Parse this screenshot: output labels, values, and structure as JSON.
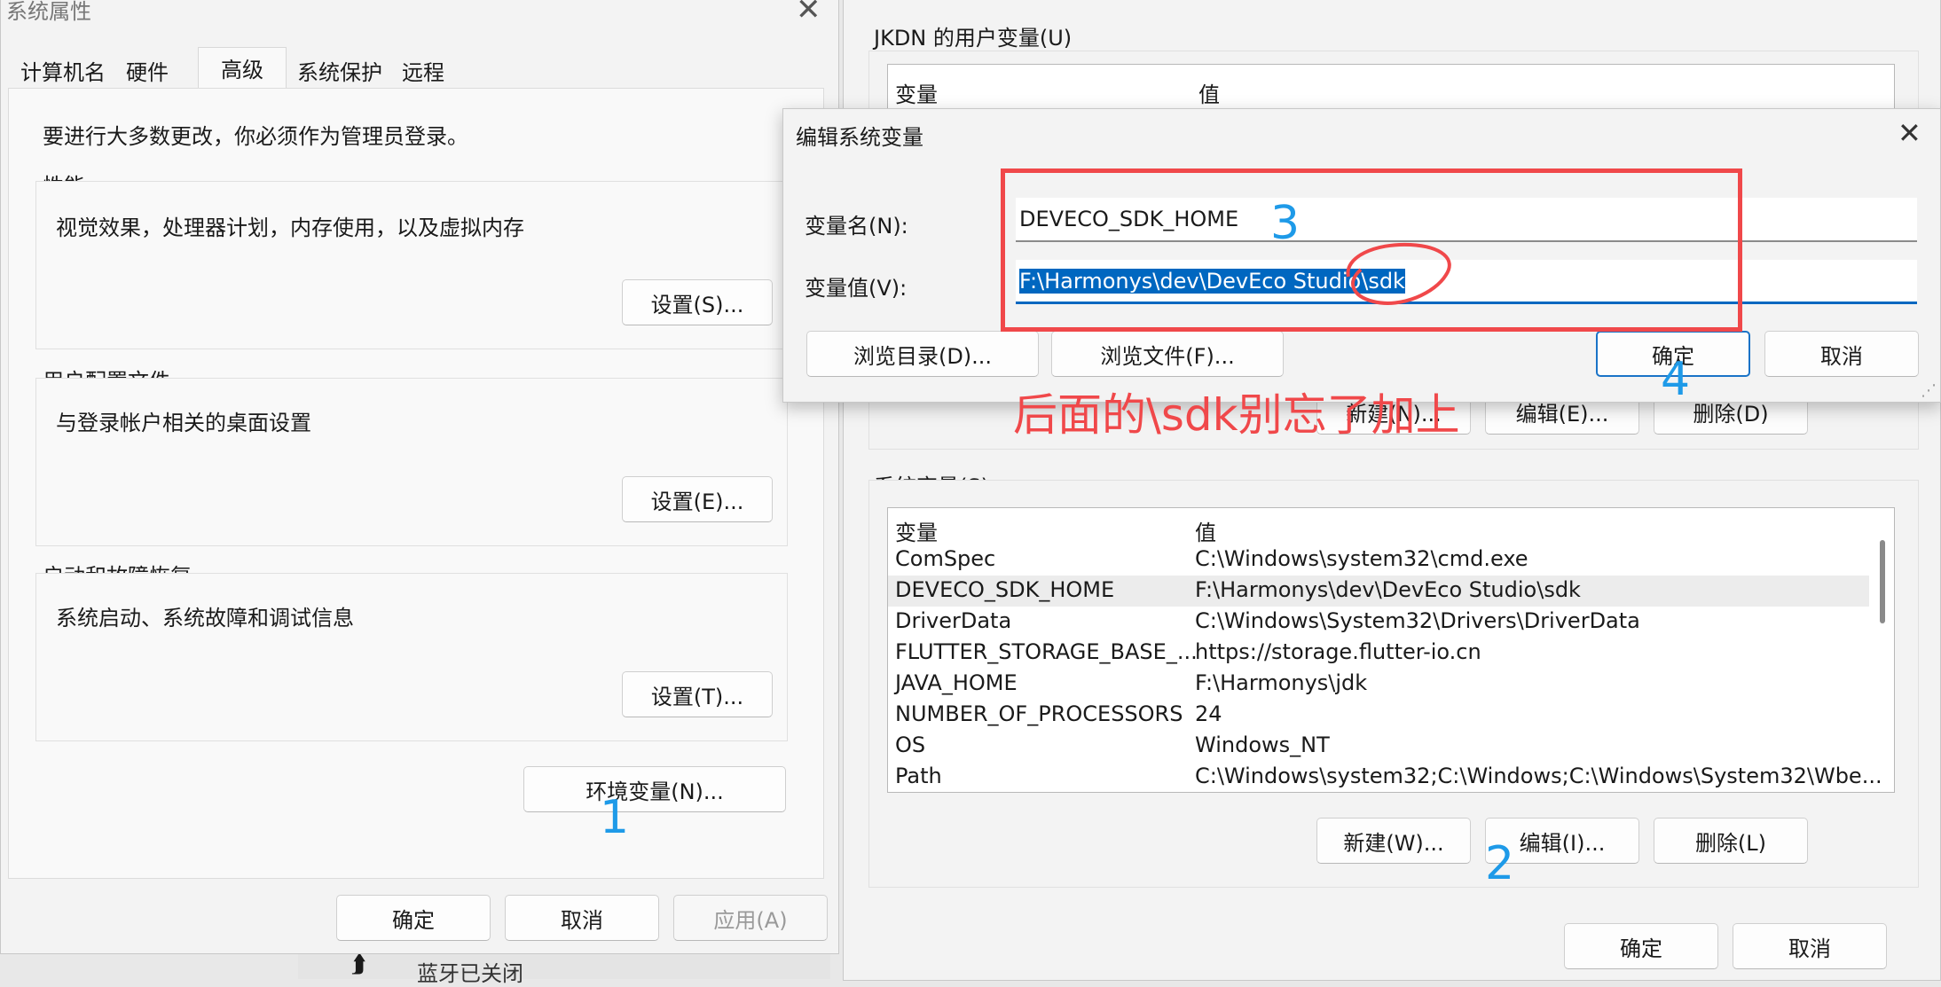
{
  "left_window": {
    "title": "系统属性",
    "tabs": [
      "计算机名",
      "硬件",
      "高级",
      "系统保护",
      "远程"
    ],
    "active_tab": "高级",
    "admin_note": "要进行大多数更改，你必须作为管理员登录。",
    "performance": {
      "title": "性能",
      "desc": "视觉效果，处理器计划，内存使用，以及虚拟内存",
      "button": "设置(S)..."
    },
    "user_profiles": {
      "title": "用户配置文件",
      "desc": "与登录帐户相关的桌面设置",
      "button": "设置(E)..."
    },
    "startup": {
      "title": "启动和故障恢复",
      "desc": "系统启动、系统故障和调试信息",
      "button": "设置(T)..."
    },
    "env_button": "环境变量(N)...",
    "ok": "确定",
    "cancel": "取消",
    "apply": "应用(A)"
  },
  "taskbar_peek": {
    "text": "蓝牙已关闭"
  },
  "env_window": {
    "user_section_title": "JKDN 的用户变量(U)",
    "col_var": "变量",
    "col_val": "值",
    "user_buttons": {
      "new": "新建(N)...",
      "edit": "编辑(E)...",
      "delete": "删除(D)"
    },
    "system_section_title": "系统变量(S)",
    "system_rows": [
      {
        "name": "ComSpec",
        "value": "C:\\Windows\\system32\\cmd.exe"
      },
      {
        "name": "DEVECO_SDK_HOME",
        "value": "F:\\Harmonys\\dev\\DevEco Studio\\sdk"
      },
      {
        "name": "DriverData",
        "value": "C:\\Windows\\System32\\Drivers\\DriverData"
      },
      {
        "name": "FLUTTER_STORAGE_BASE_...",
        "value": "https://storage.flutter-io.cn"
      },
      {
        "name": "JAVA_HOME",
        "value": "F:\\Harmonys\\jdk"
      },
      {
        "name": "NUMBER_OF_PROCESSORS",
        "value": "24"
      },
      {
        "name": "OS",
        "value": "Windows_NT"
      },
      {
        "name": "Path",
        "value": "C:\\Windows\\system32;C:\\Windows;C:\\Windows\\System32\\Wbe..."
      }
    ],
    "system_buttons": {
      "new": "新建(W)...",
      "edit": "编辑(I)...",
      "delete": "删除(L)"
    },
    "ok": "确定",
    "cancel": "取消"
  },
  "edit_dialog": {
    "title": "编辑系统变量",
    "name_label": "变量名(N):",
    "name_value": "DEVECO_SDK_HOME",
    "value_label": "变量值(V):",
    "value_value": "F:\\Harmonys\\dev\\DevEco Studio\\sdk",
    "browse_dir": "浏览目录(D)...",
    "browse_file": "浏览文件(F)...",
    "ok": "确定",
    "cancel": "取消"
  },
  "annotations": {
    "step1": "1",
    "step2": "2",
    "step3": "3",
    "step4": "4",
    "note": "后面的\\sdk别忘了加上",
    "note_color": "#f0484a",
    "step_color": "#1e9ae8"
  }
}
